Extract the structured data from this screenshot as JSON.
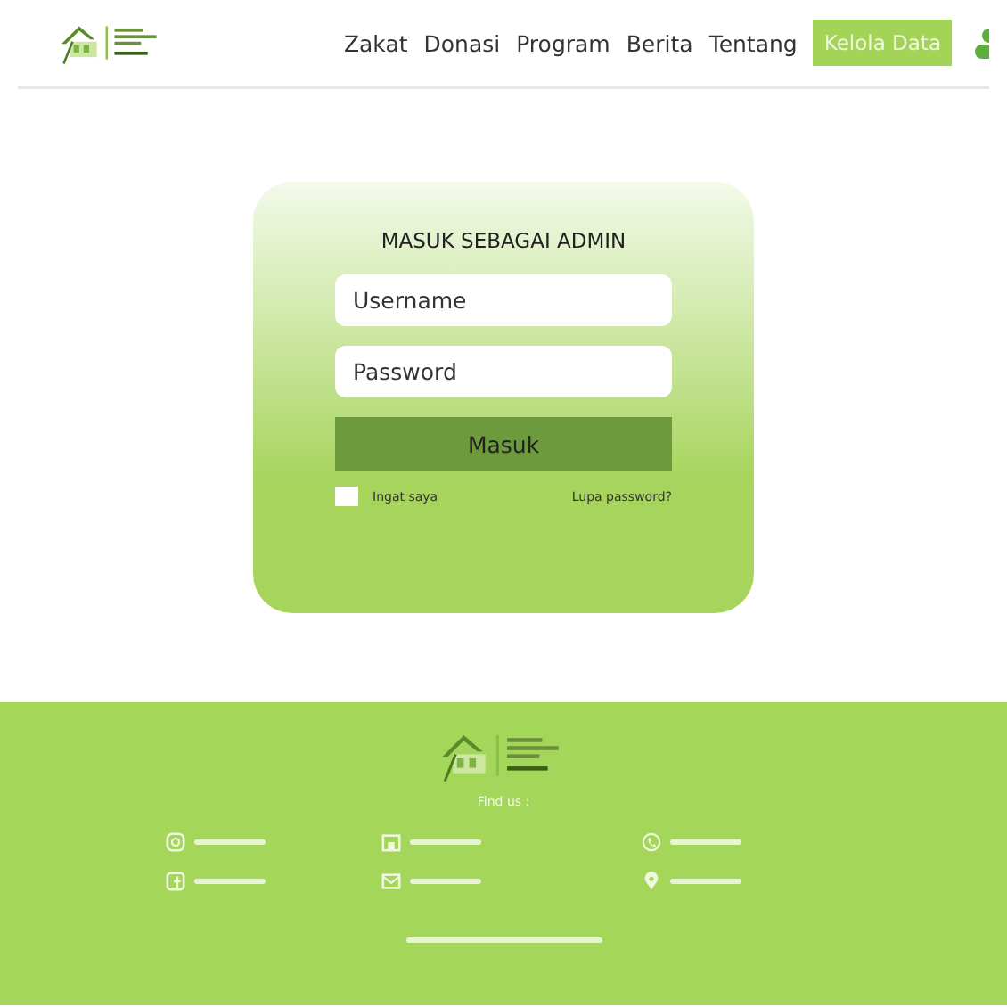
{
  "nav": {
    "links": [
      {
        "label": "Zakat"
      },
      {
        "label": "Donasi"
      },
      {
        "label": "Program"
      },
      {
        "label": "Berita"
      },
      {
        "label": "Tentang"
      }
    ],
    "cta": "Kelola Data"
  },
  "login": {
    "title": "MASUK SEBAGAI ADMIN",
    "username": {
      "placeholder": "Username"
    },
    "password": {
      "placeholder": "Password"
    },
    "submit": "Masuk",
    "remember": {
      "label": "Ingat saya",
      "checked": false
    },
    "forgot": "Lupa password?"
  },
  "footer": {
    "find_us": "Find us :"
  }
}
